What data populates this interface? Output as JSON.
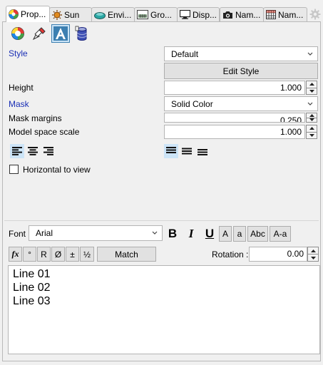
{
  "tabs": [
    {
      "label": "Prop...",
      "icon": "color-wheel-icon",
      "active": true
    },
    {
      "label": "Sun",
      "icon": "sun-icon"
    },
    {
      "label": "Envi...",
      "icon": "environment-icon"
    },
    {
      "label": "Gro...",
      "icon": "ground-plane-icon"
    },
    {
      "label": "Disp...",
      "icon": "display-monitor-icon"
    },
    {
      "label": "Nam...",
      "icon": "camera-icon"
    },
    {
      "label": "Nam...",
      "icon": "grid-icon"
    }
  ],
  "toolbar": {
    "icons": [
      "object-color-icon",
      "material-brush-icon",
      "text-annotation-icon",
      "database-icon"
    ]
  },
  "properties": {
    "style_label": "Style",
    "style_value": "Default",
    "edit_style_label": "Edit Style",
    "height_label": "Height",
    "height_value": "1.000",
    "mask_label": "Mask",
    "mask_value": "Solid Color",
    "mask_margins_label": "Mask margins",
    "mask_margins_value": "0.250",
    "model_space_scale_label": "Model space scale",
    "model_space_scale_value": "1.000",
    "horizontal_to_view_label": "Horizontal to view",
    "horizontal_to_view_checked": false
  },
  "format": {
    "font_label": "Font",
    "font_value": "Arial",
    "bold": "B",
    "italic": "I",
    "underline": "U",
    "size_large": "A",
    "size_small": "a",
    "capitalize": "Abc",
    "case_toggle": "A-a"
  },
  "symbols": {
    "fx": "fx",
    "degree": "°",
    "radius": "R",
    "diameter": "Ø",
    "plus_minus": "±",
    "half": "½",
    "match": "Match",
    "rotation_label": "Rotation :",
    "rotation_value": "0.00"
  },
  "text_content": [
    "Line 01",
    "Line 02",
    "Line 03"
  ],
  "colors": {
    "accent_blue": "#1a2fb5",
    "selected_bg": "#cce4f7",
    "selected_border": "#3c7fb1"
  }
}
